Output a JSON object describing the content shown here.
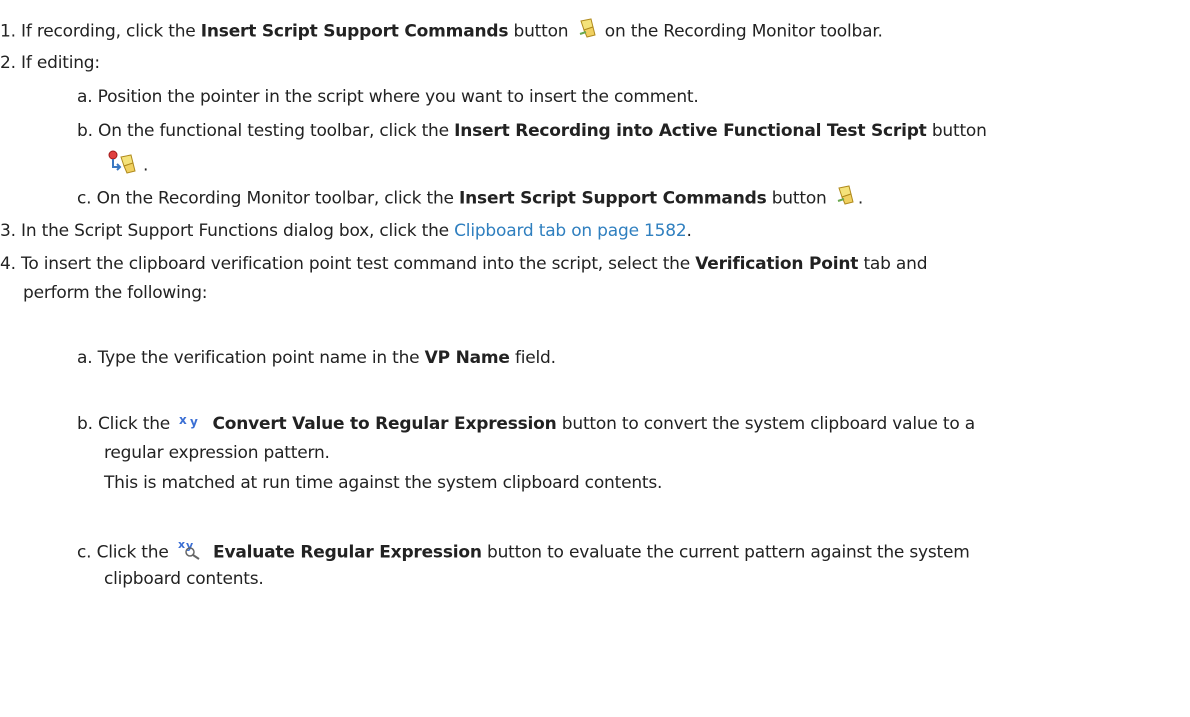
{
  "step1": {
    "num": "1.",
    "t1": "If recording, click the",
    "b1": "Insert Script Support Commands",
    "t2": "button",
    "t3": "on the Recording Monitor toolbar.",
    "icon": "script-support-icon"
  },
  "step2": {
    "num": "2.",
    "t1": "If editing:",
    "a": {
      "num": "a.",
      "text": "Position the pointer in the script where you want to insert the comment."
    },
    "b": {
      "num": "b.",
      "t1": "On the functional testing toolbar, click the",
      "b1": "Insert Recording into Active Functional Test Script",
      "t2": "button",
      "t3": ".",
      "icon": "insert-recording-icon"
    },
    "c": {
      "num": "c.",
      "t1": "On the Recording Monitor toolbar, click the",
      "b1": "Insert Script Support Commands",
      "t2": "button",
      "t3": ".",
      "icon": "script-support-icon"
    }
  },
  "step3": {
    "num": "3.",
    "t1": "In the Script Support Functions dialog box, click the",
    "link": "Clipboard tab on page 1582",
    "t2": "."
  },
  "step4": {
    "num": "4.",
    "line1_t1": "To insert the clipboard verification point test command into the script, select the",
    "line1_b1": "Verification Point",
    "line1_t2": "tab and",
    "line2": "perform the following:",
    "a": {
      "num": "a.",
      "t1": "Type the verification point name in the",
      "b1": "VP Name",
      "t2": "field."
    },
    "b": {
      "num": "b.",
      "t1": "Click the",
      "b1": "Convert Value to Regular Expression",
      "t2": "button to convert the system clipboard value to a",
      "line2": "regular expression pattern.",
      "line3": "This is matched at run time against the system clipboard contents.",
      "icon": "xy-regex-icon"
    },
    "c": {
      "num": "c.",
      "t1": "Click the",
      "b1": "Evaluate Regular Expression",
      "t2": "button to evaluate the current pattern against the system",
      "line2": "clipboard contents.",
      "icon": "evaluate-regex-icon"
    }
  },
  "colors": {
    "text": "#222222",
    "link": "#2f7fbf"
  }
}
